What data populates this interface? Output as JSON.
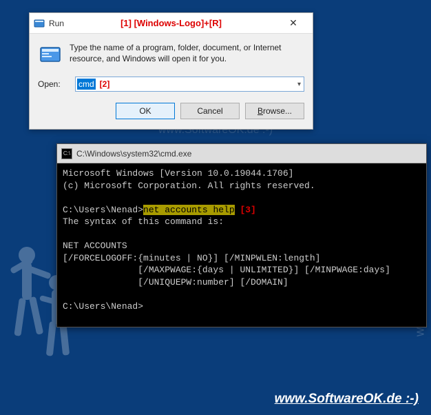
{
  "run": {
    "title": "Run",
    "annotation": "[1]  [Windows-Logo]+[R]",
    "description": "Type the name of a program, folder, document, or Internet resource, and Windows will open it for you.",
    "open_label": "Open:",
    "open_value": "cmd",
    "open_annotation": "[2]",
    "ok_label": "OK",
    "cancel_label": "Cancel",
    "browse_label": "Browse...",
    "close_tooltip": "Close"
  },
  "cmd": {
    "title": "C:\\Windows\\system32\\cmd.exe",
    "lines": {
      "l1": "Microsoft Windows [Version 10.0.19044.1706]",
      "l2": "(c) Microsoft Corporation. All rights reserved.",
      "l3_prompt": "C:\\Users\\Nenad>",
      "l3_cmd": "net accounts help",
      "l3_annot": " [3]",
      "l4": "The syntax of this command is:",
      "l5": "NET ACCOUNTS",
      "l6": "[/FORCELOGOFF:{minutes | NO}] [/MINPWLEN:length]",
      "l7": "              [/MAXPWAGE:{days | UNLIMITED}] [/MINPWAGE:days]",
      "l8": "              [/UNIQUEPW:number] [/DOMAIN]",
      "l9": "C:\\Users\\Nenad>"
    }
  },
  "watermark": "www.SoftwareOK.de :-)",
  "footer": "www.SoftwareOK.de :-)"
}
